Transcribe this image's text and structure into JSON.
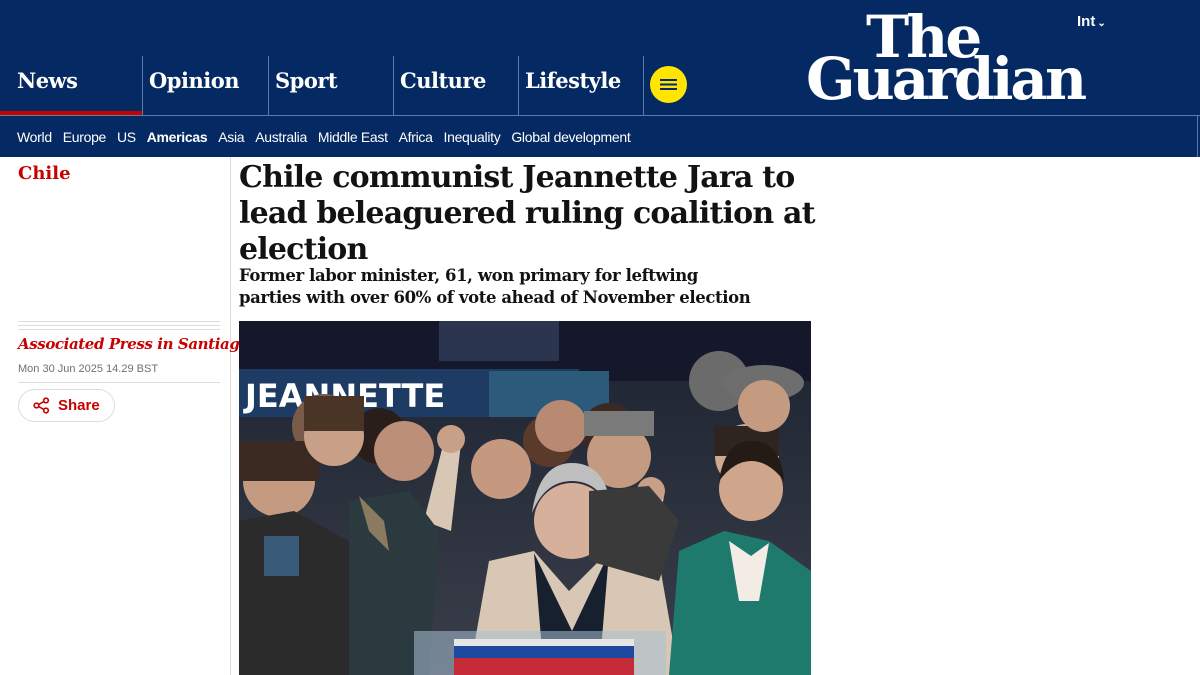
{
  "header": {
    "edition": "Int",
    "logo_line1": "The",
    "logo_line2": "Guardian",
    "pillars": [
      "News",
      "Opinion",
      "Sport",
      "Culture",
      "Lifestyle"
    ],
    "active_pillar": "News",
    "subnav": [
      "World",
      "Europe",
      "US",
      "Americas",
      "Asia",
      "Australia",
      "Middle East",
      "Africa",
      "Inequality",
      "Global development"
    ],
    "active_subnav": "Americas"
  },
  "article": {
    "section": "Chile",
    "headline": "Chile communist Jeannette Jara to lead beleaguered ruling coalition at election",
    "standfirst": "Former labor minister, 61, won primary for leftwing parties with over 60% of vote ahead of November election",
    "byline": "Associated Press in Santiago",
    "date": "Mon 30 Jun 2025 14.29 BST",
    "share_label": "Share",
    "photo_banner_text": "JEANNETTE"
  },
  "colors": {
    "brand_blue": "#052962",
    "news_red": "#c70000",
    "menu_yellow": "#ffe500"
  },
  "icons": [
    "menu-icon",
    "share-icon",
    "chevron-down-icon"
  ]
}
